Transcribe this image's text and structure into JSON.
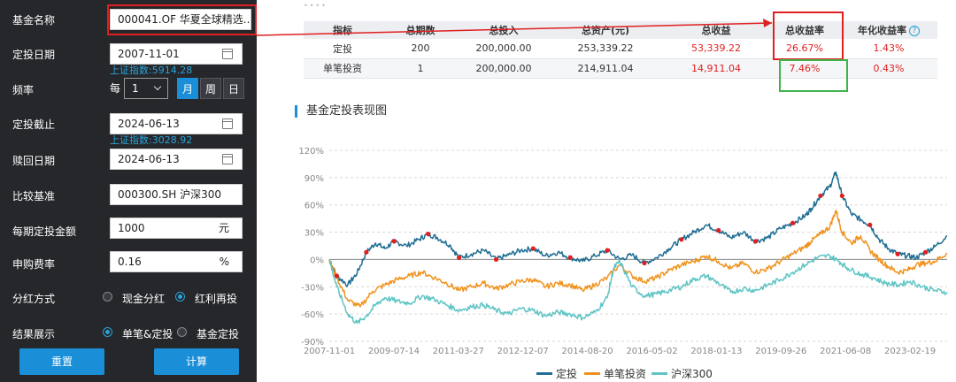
{
  "form": {
    "fund_name_label": "基金名称",
    "fund_name_value": "000041.OF 华夏全球精选...",
    "start_date_label": "定投日期",
    "start_date_value": "2007-11-01",
    "start_index_hint": "上证指数:5914.28",
    "frequency_label": "频率",
    "frequency_every": "每",
    "frequency_count": "1",
    "frequency_units": [
      "月",
      "周",
      "日"
    ],
    "frequency_selected": "月",
    "end_date_label": "定投截止",
    "end_date_value": "2024-06-13",
    "end_index_hint": "上证指数:3028.92",
    "redeem_date_label": "赎回日期",
    "redeem_date_value": "2024-06-13",
    "benchmark_label": "比较基准",
    "benchmark_value": "000300.SH 沪深300",
    "amount_label": "每期定投金额",
    "amount_value": "1000",
    "amount_unit": "元",
    "fee_label": "申购费率",
    "fee_value": "0.16",
    "fee_unit": "%",
    "dividend_label": "分红方式",
    "dividend_options": [
      "现金分红",
      "红利再投"
    ],
    "dividend_selected": "红利再投",
    "display_label": "结果展示",
    "display_options": [
      "单笔&定投",
      "基金定投"
    ],
    "display_selected": "单笔&定投",
    "reset_button": "重置",
    "calc_button": "计算"
  },
  "result_table": {
    "headers": [
      "指标",
      "总期数",
      "总投入",
      "总资产(元)",
      "总收益",
      "总收益率",
      "年化收益率"
    ],
    "rows": [
      [
        "定投",
        "200",
        "200,000.00",
        "253,339.22",
        "53,339.22",
        "26.67%",
        "1.43%"
      ],
      [
        "单笔投资",
        "1",
        "200,000.00",
        "214,911.04",
        "14,911.04",
        "7.46%",
        "0.43%"
      ]
    ]
  },
  "chart_section_title": "基金定投表现图",
  "colors": {
    "dingtou": "#1f6e93",
    "single": "#f0931e",
    "hs300": "#5ec4c4",
    "buy_marker": "#e02020",
    "accent": "#1a8fd8",
    "annotation_red": "#e02020",
    "annotation_green": "#3fb44b"
  },
  "chart_data": {
    "type": "line",
    "x_ticks": [
      "2007-11-01",
      "2009-07-14",
      "2011-03-27",
      "2012-12-07",
      "2014-08-20",
      "2016-05-02",
      "2018-01-13",
      "2019-09-26",
      "2021-06-08",
      "2023-02-19"
    ],
    "y_ticks": [
      "120%",
      "90%",
      "60%",
      "30%",
      "0%",
      "-30%",
      "-60%",
      "-90%"
    ],
    "ylim": [
      -90,
      120
    ],
    "x_range": [
      "2007-11-01",
      "2024-06-13"
    ],
    "series": [
      {
        "name": "定投",
        "color": "#1f6e93",
        "points": [
          [
            0,
            0
          ],
          [
            0.012,
            -18
          ],
          [
            0.03,
            -28
          ],
          [
            0.045,
            -15
          ],
          [
            0.06,
            8
          ],
          [
            0.075,
            18
          ],
          [
            0.09,
            12
          ],
          [
            0.105,
            20
          ],
          [
            0.125,
            15
          ],
          [
            0.145,
            22
          ],
          [
            0.16,
            28
          ],
          [
            0.175,
            24
          ],
          [
            0.195,
            16
          ],
          [
            0.21,
            2
          ],
          [
            0.23,
            6
          ],
          [
            0.25,
            10
          ],
          [
            0.27,
            0
          ],
          [
            0.29,
            5
          ],
          [
            0.31,
            10
          ],
          [
            0.33,
            12
          ],
          [
            0.35,
            4
          ],
          [
            0.37,
            8
          ],
          [
            0.39,
            2
          ],
          [
            0.41,
            -2
          ],
          [
            0.43,
            4
          ],
          [
            0.45,
            10
          ],
          [
            0.47,
            0
          ],
          [
            0.49,
            5
          ],
          [
            0.51,
            -4
          ],
          [
            0.53,
            2
          ],
          [
            0.55,
            12
          ],
          [
            0.57,
            22
          ],
          [
            0.59,
            30
          ],
          [
            0.61,
            38
          ],
          [
            0.63,
            32
          ],
          [
            0.65,
            24
          ],
          [
            0.67,
            30
          ],
          [
            0.69,
            20
          ],
          [
            0.71,
            24
          ],
          [
            0.73,
            34
          ],
          [
            0.75,
            40
          ],
          [
            0.77,
            48
          ],
          [
            0.78,
            56
          ],
          [
            0.795,
            70
          ],
          [
            0.81,
            80
          ],
          [
            0.82,
            96
          ],
          [
            0.83,
            70
          ],
          [
            0.845,
            50
          ],
          [
            0.86,
            44
          ],
          [
            0.875,
            38
          ],
          [
            0.89,
            22
          ],
          [
            0.905,
            12
          ],
          [
            0.92,
            6
          ],
          [
            0.935,
            4
          ],
          [
            0.95,
            2
          ],
          [
            0.965,
            8
          ],
          [
            0.98,
            14
          ],
          [
            1.0,
            26
          ]
        ]
      },
      {
        "name": "单笔投资",
        "color": "#f0931e",
        "points": [
          [
            0,
            0
          ],
          [
            0.012,
            -20
          ],
          [
            0.03,
            -45
          ],
          [
            0.05,
            -52
          ],
          [
            0.07,
            -35
          ],
          [
            0.09,
            -28
          ],
          [
            0.11,
            -22
          ],
          [
            0.13,
            -18
          ],
          [
            0.15,
            -14
          ],
          [
            0.17,
            -20
          ],
          [
            0.19,
            -26
          ],
          [
            0.21,
            -34
          ],
          [
            0.23,
            -30
          ],
          [
            0.25,
            -26
          ],
          [
            0.27,
            -32
          ],
          [
            0.29,
            -28
          ],
          [
            0.31,
            -24
          ],
          [
            0.33,
            -22
          ],
          [
            0.35,
            -30
          ],
          [
            0.37,
            -26
          ],
          [
            0.39,
            -28
          ],
          [
            0.41,
            -34
          ],
          [
            0.43,
            -28
          ],
          [
            0.45,
            -20
          ],
          [
            0.47,
            -6
          ],
          [
            0.49,
            -18
          ],
          [
            0.51,
            -24
          ],
          [
            0.53,
            -20
          ],
          [
            0.55,
            -12
          ],
          [
            0.57,
            -6
          ],
          [
            0.59,
            -2
          ],
          [
            0.61,
            4
          ],
          [
            0.63,
            -2
          ],
          [
            0.65,
            -10
          ],
          [
            0.67,
            -4
          ],
          [
            0.69,
            -14
          ],
          [
            0.71,
            -10
          ],
          [
            0.73,
            -2
          ],
          [
            0.75,
            6
          ],
          [
            0.77,
            14
          ],
          [
            0.78,
            20
          ],
          [
            0.795,
            28
          ],
          [
            0.81,
            36
          ],
          [
            0.82,
            54
          ],
          [
            0.83,
            30
          ],
          [
            0.845,
            18
          ],
          [
            0.86,
            26
          ],
          [
            0.875,
            10
          ],
          [
            0.89,
            0
          ],
          [
            0.905,
            -8
          ],
          [
            0.92,
            -14
          ],
          [
            0.935,
            -12
          ],
          [
            0.95,
            -6
          ],
          [
            0.965,
            -4
          ],
          [
            0.98,
            -2
          ],
          [
            1.0,
            7
          ]
        ]
      },
      {
        "name": "沪深300",
        "color": "#5ec4c4",
        "points": [
          [
            0,
            0
          ],
          [
            0.012,
            -30
          ],
          [
            0.03,
            -60
          ],
          [
            0.045,
            -70
          ],
          [
            0.06,
            -62
          ],
          [
            0.075,
            -50
          ],
          [
            0.09,
            -42
          ],
          [
            0.11,
            -46
          ],
          [
            0.13,
            -48
          ],
          [
            0.15,
            -40
          ],
          [
            0.17,
            -44
          ],
          [
            0.19,
            -50
          ],
          [
            0.21,
            -56
          ],
          [
            0.23,
            -52
          ],
          [
            0.25,
            -50
          ],
          [
            0.27,
            -56
          ],
          [
            0.29,
            -60
          ],
          [
            0.31,
            -54
          ],
          [
            0.33,
            -56
          ],
          [
            0.35,
            -62
          ],
          [
            0.37,
            -58
          ],
          [
            0.39,
            -60
          ],
          [
            0.41,
            -64
          ],
          [
            0.43,
            -58
          ],
          [
            0.45,
            -42
          ],
          [
            0.46,
            -10
          ],
          [
            0.47,
            -2
          ],
          [
            0.49,
            -30
          ],
          [
            0.51,
            -40
          ],
          [
            0.53,
            -38
          ],
          [
            0.55,
            -34
          ],
          [
            0.57,
            -30
          ],
          [
            0.59,
            -22
          ],
          [
            0.61,
            -18
          ],
          [
            0.63,
            -26
          ],
          [
            0.65,
            -36
          ],
          [
            0.67,
            -32
          ],
          [
            0.69,
            -34
          ],
          [
            0.71,
            -28
          ],
          [
            0.73,
            -22
          ],
          [
            0.75,
            -14
          ],
          [
            0.77,
            -6
          ],
          [
            0.79,
            2
          ],
          [
            0.81,
            4
          ],
          [
            0.825,
            -2
          ],
          [
            0.84,
            -10
          ],
          [
            0.86,
            -16
          ],
          [
            0.88,
            -20
          ],
          [
            0.9,
            -26
          ],
          [
            0.92,
            -28
          ],
          [
            0.94,
            -24
          ],
          [
            0.96,
            -30
          ],
          [
            0.98,
            -34
          ],
          [
            1.0,
            -36
          ]
        ]
      }
    ],
    "buy_markers_on": "定投"
  },
  "legend": [
    "定投",
    "单笔投资",
    "沪深300"
  ]
}
